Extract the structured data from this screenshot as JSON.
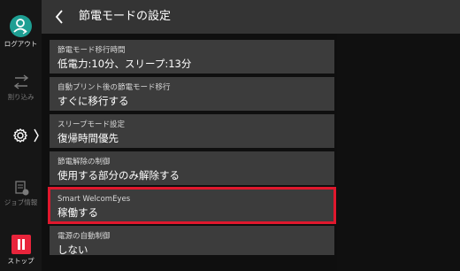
{
  "sidebar": {
    "logout_label": "ログアウト",
    "interrupt_label": "割り込み",
    "job_info_label": "ジョブ情報",
    "stop_label": "ストップ"
  },
  "header": {
    "title": "節電モードの設定"
  },
  "settings": [
    {
      "label": "節電モード移行時間",
      "value": "低電力:10分、スリープ:13分"
    },
    {
      "label": "自動プリント後の節電モード移行",
      "value": "すぐに移行する"
    },
    {
      "label": "スリープモード設定",
      "value": "復帰時間優先"
    },
    {
      "label": "節電解除の制御",
      "value": "使用する部分のみ解除する"
    },
    {
      "label": "Smart WelcomEyes",
      "value": "稼働する"
    },
    {
      "label": "電源の自動制御",
      "value": "しない"
    }
  ],
  "colors": {
    "logout_accent": "#1e9f93",
    "stop_accent": "#e8243b",
    "highlight": "#e0182d"
  }
}
